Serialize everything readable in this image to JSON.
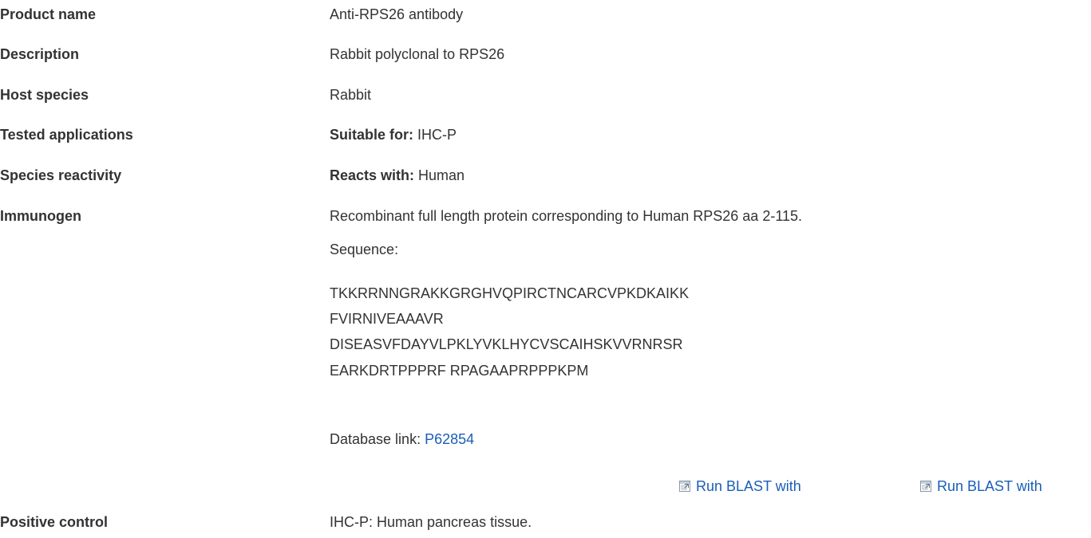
{
  "rows": {
    "product_name": {
      "label": "Product name",
      "value": "Anti-RPS26 antibody"
    },
    "description": {
      "label": "Description",
      "value": "Rabbit polyclonal to RPS26"
    },
    "host_species": {
      "label": "Host species",
      "value": "Rabbit"
    },
    "tested_applications": {
      "label": "Tested applications",
      "prefix": "Suitable for:",
      "value": "IHC-P"
    },
    "species_reactivity": {
      "label": "Species reactivity",
      "prefix": "Reacts with:",
      "value": "Human"
    },
    "immunogen": {
      "label": "Immunogen",
      "value": "Recombinant full length protein corresponding to Human RPS26 aa 2-115.",
      "sequence_label": "Sequence:",
      "sequence_lines": [
        "TKKRRNNGRAKKGRGHVQPIRCTNCARCVPKDKAIKK",
        "FVIRNIVEAAAVR",
        "DISEASVFDAYVLPKLYVKLHYCVSCAIHSKVVRNRSR",
        "EARKDRTPPPRF RPAGAAPRPPPKPM"
      ],
      "database_link_label": "Database link:",
      "database_link_value": "P62854",
      "blast_links": [
        "Run BLAST with",
        "Run BLAST with"
      ]
    },
    "positive_control": {
      "label": "Positive control",
      "value": "IHC-P: Human pancreas tissue."
    }
  },
  "colors": {
    "text": "#333333",
    "link": "#1a5eb8"
  },
  "icons": [
    "external-window-icon"
  ]
}
